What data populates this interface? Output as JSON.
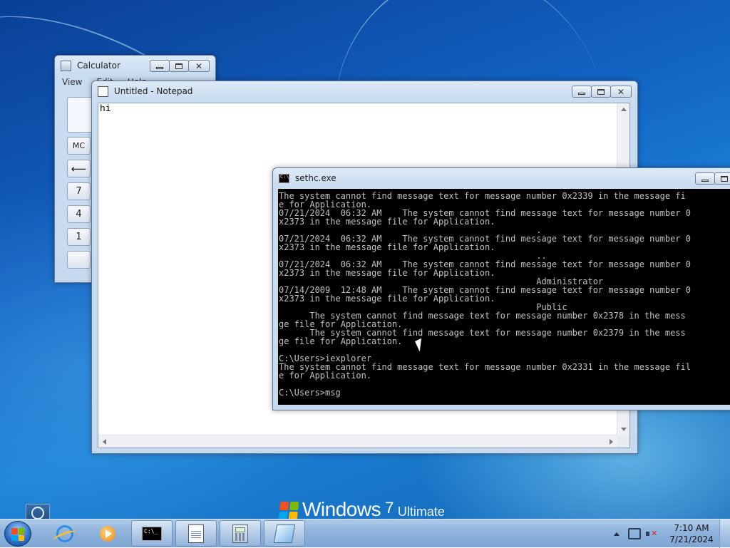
{
  "desktop": {
    "watermark": {
      "name": "Windows",
      "version_num": "7",
      "edition": "Ultimate"
    }
  },
  "calculator": {
    "title": "Calculator",
    "menu": [
      "View",
      "Edit",
      "Help"
    ],
    "buttons": {
      "mc": "MC",
      "back": "⟵",
      "seven": "7",
      "four": "4",
      "one": "1"
    }
  },
  "notepad": {
    "title": "Untitled - Notepad",
    "content": "hi"
  },
  "console": {
    "title": "sethc.exe",
    "lines": [
      "The system cannot find message text for message number 0x2339 in the message fi",
      "e for Application.",
      "07/21/2024  06:32 AM    The system cannot find message text for message number 0",
      "x2373 in the message file for Application.",
      "                                                  .",
      "07/21/2024  06:32 AM    The system cannot find message text for message number 0",
      "x2373 in the message file for Application.",
      "                                                  ..",
      "07/21/2024  06:32 AM    The system cannot find message text for message number 0",
      "x2373 in the message file for Application.",
      "                                                  Administrator",
      "07/14/2009  12:48 AM    The system cannot find message text for message number 0",
      "x2373 in the message file for Application.",
      "                                                  Public",
      "      The system cannot find message text for message number 0x2378 in the mess",
      "ge file for Application.",
      "      The system cannot find message text for message number 0x2379 in the mess",
      "ge file for Application.",
      "",
      "C:\\Users>iexplorer",
      "The system cannot find message text for message number 0x2331 in the message fil",
      "e for Application.",
      "",
      "C:\\Users>msg"
    ]
  },
  "taskbar": {
    "items": [
      "Internet Explorer",
      "Windows Media Player",
      "sethc.exe",
      "Untitled - Notepad",
      "Calculator",
      "sethc"
    ],
    "tray": {
      "time": "7:10 AM",
      "date": "7/21/2024"
    }
  },
  "icons": [
    "start-orb-icon",
    "internet-explorer-icon",
    "media-player-icon",
    "command-prompt-icon",
    "notepad-icon",
    "calculator-icon",
    "sethc-icon",
    "gadgets-icon",
    "network-icon",
    "volume-muted-icon"
  ],
  "colors": {
    "desktop_blue": "#1263c2",
    "console_bg": "#000000",
    "console_fg": "#c0c0c0",
    "close_red": "#c7432d"
  }
}
